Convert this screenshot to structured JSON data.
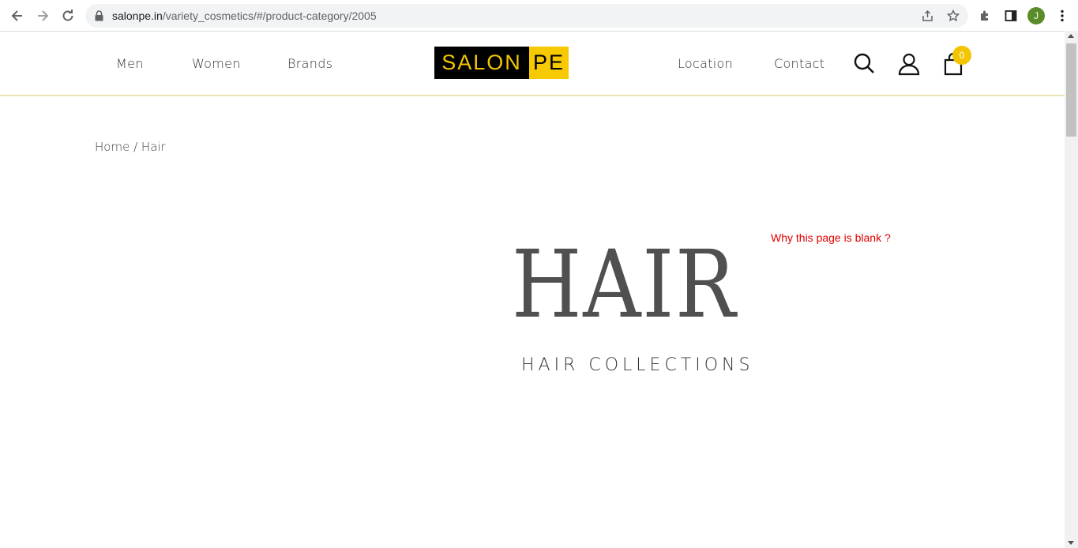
{
  "browser": {
    "url_host": "salonpe.in",
    "url_path": "/variety_cosmetics/#/product-category/2005",
    "profile_initial": "J"
  },
  "header": {
    "nav_left": [
      "Men",
      "Women",
      "Brands"
    ],
    "logo_part1": "SALON",
    "logo_part2": "PE",
    "nav_right": [
      "Location",
      "Contact"
    ],
    "cart_count": "0",
    "colors": {
      "brand_yellow": "#f6c900",
      "logo_dark": "#000000"
    }
  },
  "breadcrumb": {
    "home": "Home",
    "separator": "/",
    "current": "Hair"
  },
  "notice": "Why this page is blank ?",
  "hero": {
    "title": "HAIR",
    "subtitle": "HAIR COLLECTIONS"
  }
}
